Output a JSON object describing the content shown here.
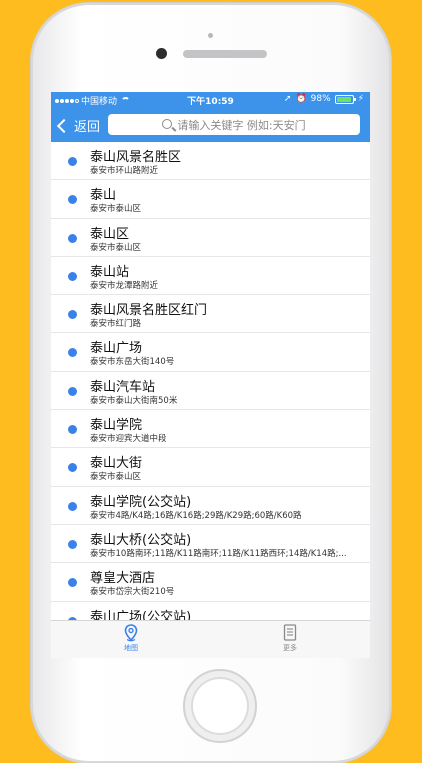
{
  "status_bar": {
    "carrier": "中国移动",
    "time": "下午10:59",
    "battery": "98%"
  },
  "nav": {
    "back_label": "返回",
    "search_placeholder": "请输入关键字 例如:天安门"
  },
  "results": [
    {
      "name": "泰山风景名胜区",
      "address": "泰安市环山路附近"
    },
    {
      "name": "泰山",
      "address": "泰安市泰山区"
    },
    {
      "name": "泰山区",
      "address": "泰安市泰山区"
    },
    {
      "name": "泰山站",
      "address": "泰安市龙潭路附近"
    },
    {
      "name": "泰山风景名胜区红门",
      "address": "泰安市红门路"
    },
    {
      "name": "泰山广场",
      "address": "泰安市东岳大街140号"
    },
    {
      "name": "泰山汽车站",
      "address": "泰安市泰山大街南50米"
    },
    {
      "name": "泰山学院",
      "address": "泰安市迎宾大道中段"
    },
    {
      "name": "泰山大街",
      "address": "泰安市泰山区"
    },
    {
      "name": "泰山学院(公交站)",
      "address": "泰安市4路/K4路;16路/K16路;29路/K29路;60路/K60路"
    },
    {
      "name": "泰山大桥(公交站)",
      "address": "泰安市10路南环;11路/K11路南环;11路/K11路西环;14路/K14路;..."
    },
    {
      "name": "尊皇大酒店",
      "address": "泰安市岱宗大街210号"
    },
    {
      "name": "泰山广场(公交站)",
      "address": ""
    }
  ],
  "tabbar": {
    "map_label": "地图",
    "more_label": "更多"
  },
  "colors": {
    "background": "#ffbc1f",
    "accent": "#3d92e9",
    "bullet": "#3b82e8"
  }
}
